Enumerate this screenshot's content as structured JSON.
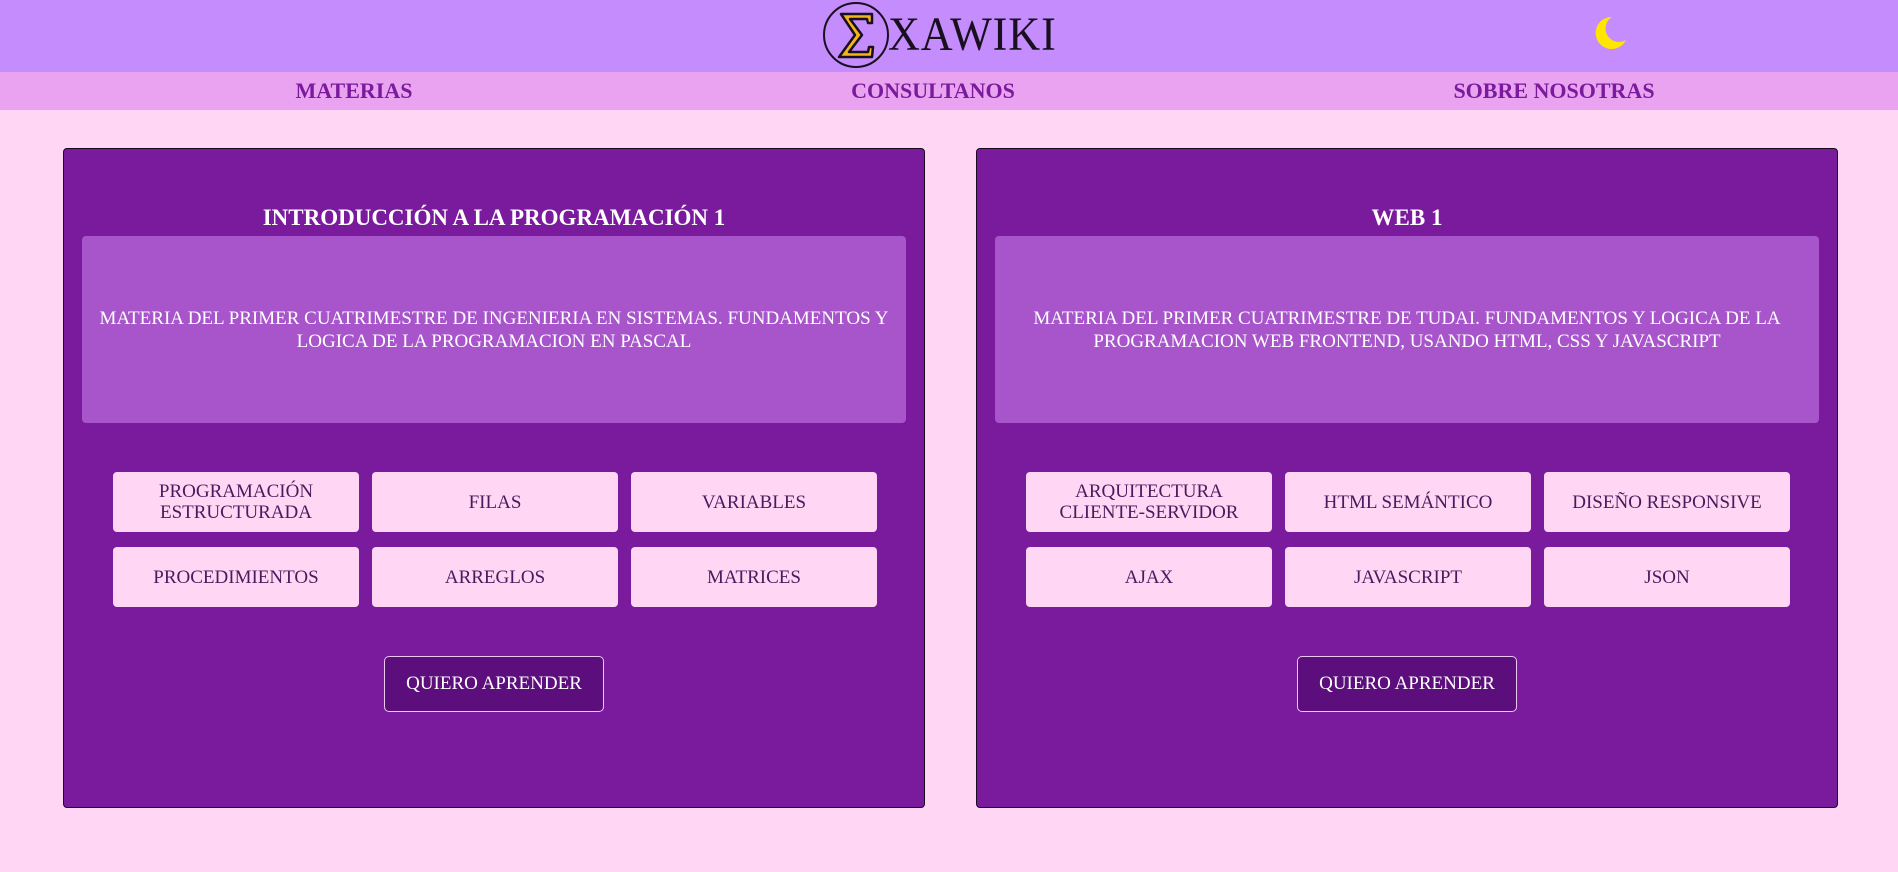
{
  "header": {
    "logo_text": "XAWIKI",
    "theme_toggle_icon": "moon-icon",
    "colors": {
      "header_bg": "#c48cfc",
      "nav_bg": "#e9a3f0",
      "page_bg": "#ffd6f4",
      "card_bg": "#7a1a9c",
      "moon": "#ffe600"
    }
  },
  "nav": {
    "items": [
      {
        "label": "MATERIAS"
      },
      {
        "label": "CONSULTANOS"
      },
      {
        "label": "SOBRE NOSOTRAS"
      }
    ]
  },
  "cards": [
    {
      "title": "INTRODUCCIÓN A LA PROGRAMACIÓN 1",
      "description": "MATERIA DEL PRIMER CUATRIMESTRE DE INGENIERIA EN SISTEMAS. FUNDAMENTOS Y LOGICA DE LA PROGRAMACION EN PASCAL",
      "topics": [
        "PROGRAMACIÓN ESTRUCTURADA",
        "FILAS",
        "VARIABLES",
        "PROCEDIMIENTOS",
        "ARREGLOS",
        "MATRICES"
      ],
      "button_label": "QUIERO APRENDER"
    },
    {
      "title": "WEB 1",
      "description": "MATERIA DEL PRIMER CUATRIMESTRE DE TUDAI. FUNDAMENTOS Y LOGICA DE LA PROGRAMACION WEB FRONTEND, USANDO HTML, CSS Y JAVASCRIPT",
      "topics": [
        "ARQUITECTURA CLIENTE-SERVIDOR",
        "HTML SEMÁNTICO",
        "DISEÑO RESPONSIVE",
        "AJAX",
        "JAVASCRIPT",
        "JSON"
      ],
      "button_label": "QUIERO APRENDER"
    }
  ]
}
